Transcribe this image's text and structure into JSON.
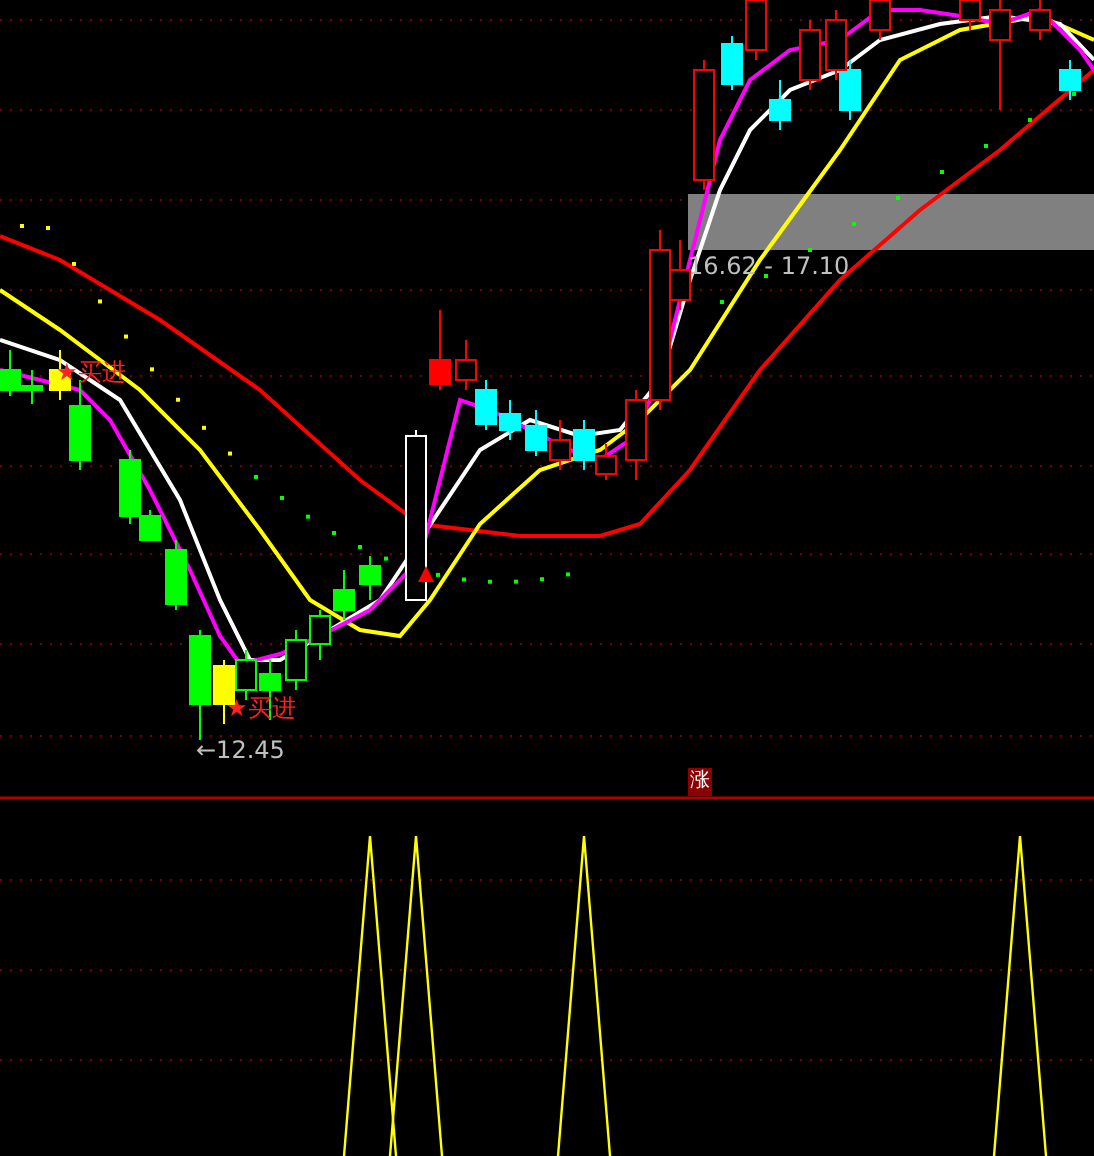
{
  "main_chart": {
    "signals": [
      {
        "marker": "★",
        "label": "买进"
      },
      {
        "marker": "★",
        "label": "买进"
      }
    ],
    "low_price_label": "←12.45",
    "zone_label": "16.62 - 17.10"
  },
  "divider_badge": "涨"
}
